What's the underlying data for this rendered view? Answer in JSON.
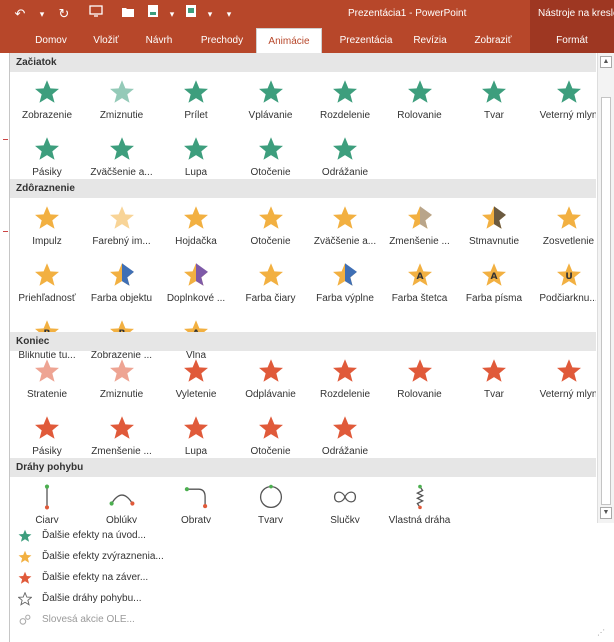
{
  "window": {
    "title": "Prezentácia1 - PowerPoint",
    "contextual_tab": "Nástroje na kreslenie"
  },
  "ribbon": {
    "tabs": [
      "Domov",
      "Vložiť",
      "Návrh",
      "Prechody",
      "Animácie",
      "Prezentácia",
      "Revízia",
      "Zobraziť",
      "Formát"
    ],
    "active_tab": "Animácie"
  },
  "colors": {
    "brand": "#b7472a",
    "entrance": "#3d9e7d",
    "emphasis": "#f2b041",
    "exit": "#e05a3a",
    "section_bg": "#e6e6e6"
  },
  "sections": [
    {
      "title": "Začiatok",
      "kind": "entrance",
      "items": [
        "Zobrazenie",
        "Zmiznutie",
        "Prílet",
        "Vplávanie",
        "Rozdelenie",
        "Rolovanie",
        "Tvar",
        "Veterný mlyn",
        "Pásiky",
        "Zväčšenie a...",
        "Lupa",
        "Otočenie",
        "Odrážanie"
      ]
    },
    {
      "title": "Zdôraznenie",
      "kind": "emphasis",
      "items": [
        "Impulz",
        "Farebný im...",
        "Hojdačka",
        "Otočenie",
        "Zväčšenie a...",
        "Zmenšenie ...",
        "Stmavnutie",
        "Zosvetlenie",
        "Priehľadnosť",
        "Farba objektu",
        "Doplnkové ...",
        "Farba čiary",
        "Farba výplne",
        "Farba štetca",
        "Farba písma",
        "Podčiarknu...",
        "Bliknutie tu...",
        "Zobrazenie ...",
        "Vlna"
      ]
    },
    {
      "title": "Koniec",
      "kind": "exit",
      "items": [
        "Stratenie",
        "Zmiznutie",
        "Vyletenie",
        "Odplávanie",
        "Rozdelenie",
        "Rolovanie",
        "Tvar",
        "Veterný mlyn",
        "Pásiky",
        "Zmenšenie ...",
        "Lupa",
        "Otočenie",
        "Odrážanie"
      ]
    },
    {
      "title": "Dráhy pohybu",
      "kind": "path",
      "items": [
        "Čiary",
        "Oblúky",
        "Obraty",
        "Tvary",
        "Slučky",
        "Vlastná dráha"
      ]
    }
  ],
  "more_effects": [
    {
      "label": "Ďalšie efekty na úvod...",
      "icon": "entrance-star-icon"
    },
    {
      "label": "Ďalšie efekty zvýraznenia...",
      "icon": "emphasis-star-icon"
    },
    {
      "label": "Ďalšie efekty na záver...",
      "icon": "exit-star-icon"
    },
    {
      "label": "Ďalšie dráhy pohybu...",
      "icon": "motion-path-star-icon"
    },
    {
      "label": "Slovesá akcie OLE...",
      "icon": "ole-action-icon",
      "disabled": true
    }
  ]
}
